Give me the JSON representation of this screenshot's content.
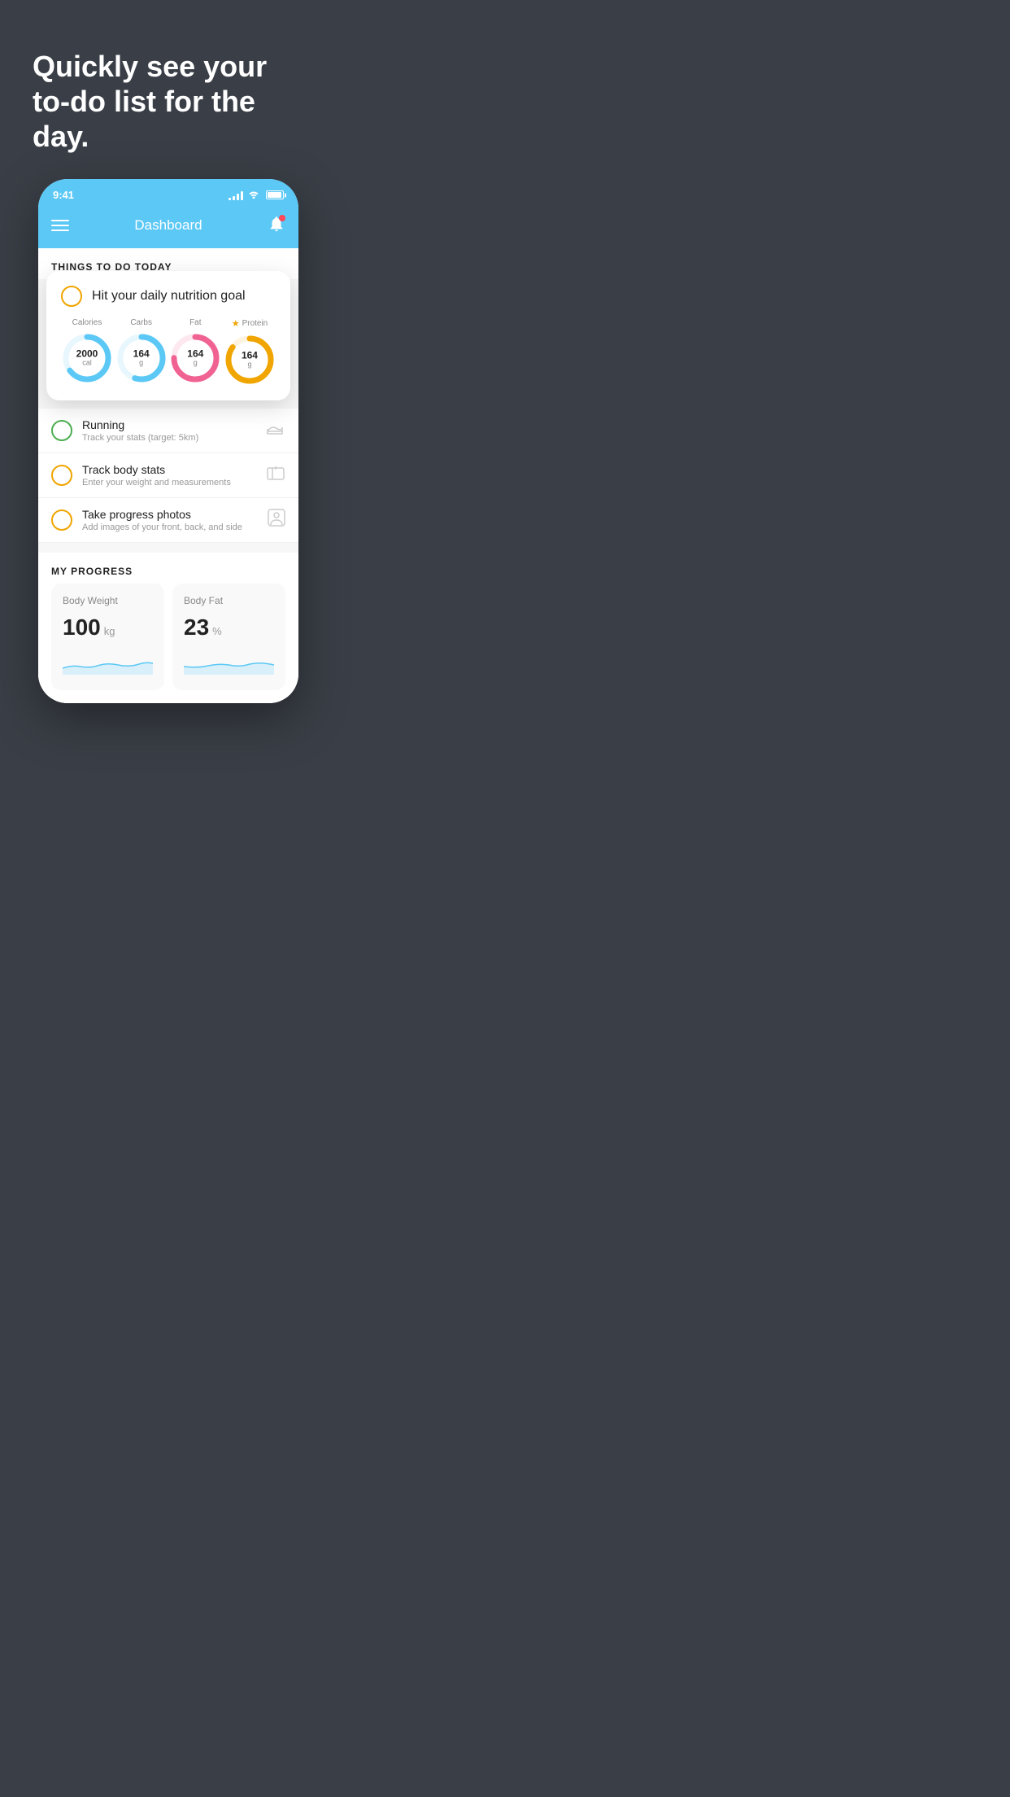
{
  "hero": {
    "title": "Quickly see your to-do list for the day."
  },
  "status_bar": {
    "time": "9:41",
    "signal": "signal",
    "wifi": "wifi",
    "battery": "battery"
  },
  "nav": {
    "title": "Dashboard",
    "menu_label": "menu",
    "bell_label": "notifications"
  },
  "things_to_do": {
    "section_title": "THINGS TO DO TODAY",
    "featured_item": {
      "title": "Hit your daily nutrition goal",
      "completed": false
    },
    "nutrition": {
      "calories": {
        "label": "Calories",
        "value": "2000",
        "unit": "cal",
        "color": "#5bc8f5",
        "percent": 65
      },
      "carbs": {
        "label": "Carbs",
        "value": "164",
        "unit": "g",
        "color": "#5bc8f5",
        "percent": 55
      },
      "fat": {
        "label": "Fat",
        "value": "164",
        "unit": "g",
        "color": "#f06292",
        "percent": 75
      },
      "protein": {
        "label": "Protein",
        "value": "164",
        "unit": "g",
        "color": "#f0a500",
        "percent": 85,
        "starred": true
      }
    },
    "todo_items": [
      {
        "title": "Running",
        "subtitle": "Track your stats (target: 5km)",
        "completed": true,
        "icon": "shoe"
      },
      {
        "title": "Track body stats",
        "subtitle": "Enter your weight and measurements",
        "completed": false,
        "icon": "scale"
      },
      {
        "title": "Take progress photos",
        "subtitle": "Add images of your front, back, and side",
        "completed": false,
        "icon": "person"
      }
    ]
  },
  "progress": {
    "section_title": "MY PROGRESS",
    "cards": [
      {
        "title": "Body Weight",
        "value": "100",
        "unit": "kg"
      },
      {
        "title": "Body Fat",
        "value": "23",
        "unit": "%"
      }
    ]
  }
}
